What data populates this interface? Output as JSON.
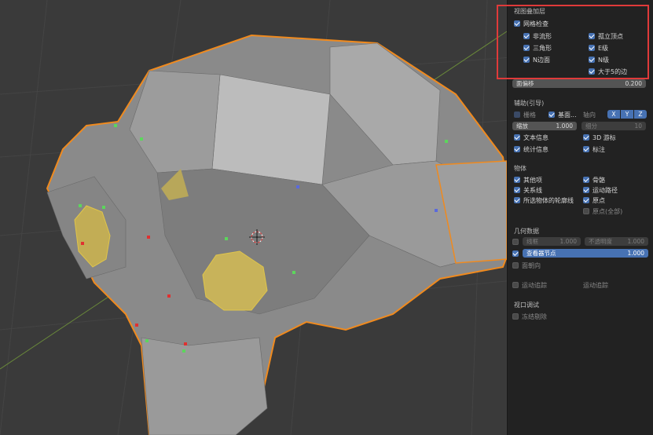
{
  "overlay": {
    "section_title": "视图叠加层",
    "mesh_check": {
      "label": "网格检查",
      "checked": true
    },
    "checks": [
      {
        "label": "非流形",
        "checked": true
      },
      {
        "label": "孤立顶点",
        "checked": true
      },
      {
        "label": "三角形",
        "checked": true
      },
      {
        "label": "E级",
        "checked": true
      },
      {
        "label": "N边面",
        "checked": true
      },
      {
        "label": "N级",
        "checked": true
      },
      {
        "label": "大于5的边",
        "checked": true
      }
    ],
    "face_offset": {
      "label": "面偏移",
      "value": "0.200"
    }
  },
  "guides": {
    "title": "辅助(引导)",
    "grid": {
      "label": "栅格",
      "checked": true
    },
    "floor": {
      "label": "基面...",
      "checked": true
    },
    "axis_label": "轴向",
    "axes": [
      "X",
      "Y",
      "Z"
    ],
    "scale": {
      "label": "缩放",
      "value": "1.000"
    },
    "subdiv": {
      "label": "细分",
      "value": "10"
    },
    "text_info": {
      "label": "文本信息",
      "checked": true
    },
    "cursor_3d": {
      "label": "3D 游标",
      "checked": true
    },
    "stats": {
      "label": "统计信息",
      "checked": true
    },
    "annotations": {
      "label": "标注",
      "checked": true
    }
  },
  "objects": {
    "title": "物体",
    "extras": {
      "label": "其他项",
      "checked": true
    },
    "bones": {
      "label": "骨骼",
      "checked": true
    },
    "relations": {
      "label": "关系线",
      "checked": true
    },
    "motion_paths": {
      "label": "运动路径",
      "checked": true
    },
    "outline": {
      "label": "所选物体的轮廓线",
      "checked": true
    },
    "origins": {
      "label": "原点",
      "checked": true
    },
    "origins_all": {
      "label": "原点(全部)",
      "checked": false
    }
  },
  "geometry": {
    "title": "几何数据",
    "wireframe": {
      "label": "线框",
      "value": "1.000",
      "checked": false
    },
    "opacity": {
      "label": "不透明度",
      "value": "1.000"
    },
    "vertex_group": {
      "label": "查看器节点",
      "value": "1.000",
      "checked": true
    },
    "face_orient": {
      "label": "面朝向",
      "checked": false
    }
  },
  "motion": {
    "tracking1": {
      "label": "运动追踪",
      "checked": false
    },
    "tracking2": {
      "label": "运动追踪"
    }
  },
  "viewport_debug": {
    "title": "视口调试",
    "freeze_cull": {
      "label": "冻结剔除",
      "checked": false
    }
  }
}
